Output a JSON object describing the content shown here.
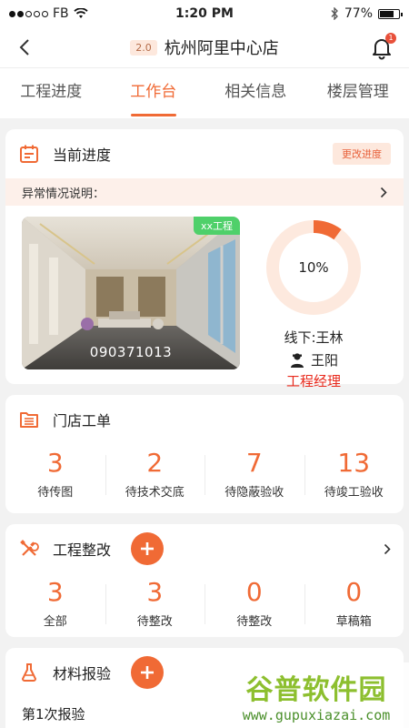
{
  "status_bar": {
    "carrier": "FB",
    "time": "1:20 PM",
    "battery": "77%",
    "battery_level": 0.77
  },
  "header": {
    "version": "2.0",
    "title": "杭州阿里中心店",
    "notification_count": "1"
  },
  "tabs": [
    {
      "label": "工程进度",
      "active": false
    },
    {
      "label": "工作台",
      "active": true
    },
    {
      "label": "相关信息",
      "active": false
    },
    {
      "label": "楼层管理",
      "active": false
    }
  ],
  "progress": {
    "title": "当前进度",
    "change_button": "更改进度",
    "abnormal_label": "异常情况说明：",
    "photo_code": "090371013",
    "photo_tag": "xx工程",
    "percent": 0.1,
    "percent_label": "10%",
    "offline_label": "线下:王林",
    "person_name": "王阳",
    "person_role": "工程经理"
  },
  "work_orders": {
    "title": "门店工单",
    "stats": [
      {
        "value": "3",
        "label": "待传图"
      },
      {
        "value": "2",
        "label": "待技术交底"
      },
      {
        "value": "7",
        "label": "待隐蔽验收"
      },
      {
        "value": "13",
        "label": "待竣工验收"
      }
    ]
  },
  "rectification": {
    "title": "工程整改",
    "stats": [
      {
        "value": "3",
        "label": "全部"
      },
      {
        "value": "3",
        "label": "待整改"
      },
      {
        "value": "0",
        "label": "待整改"
      },
      {
        "value": "0",
        "label": "草稿箱"
      }
    ]
  },
  "material": {
    "title": "材料报验",
    "first_report": "第1次报验"
  },
  "watermark": {
    "text": "谷普软件园",
    "url": "www.gupuxiazai.com"
  },
  "colors": {
    "accent": "#f06a35",
    "role_red": "#e8291c",
    "tag_green": "#4fd06a"
  }
}
